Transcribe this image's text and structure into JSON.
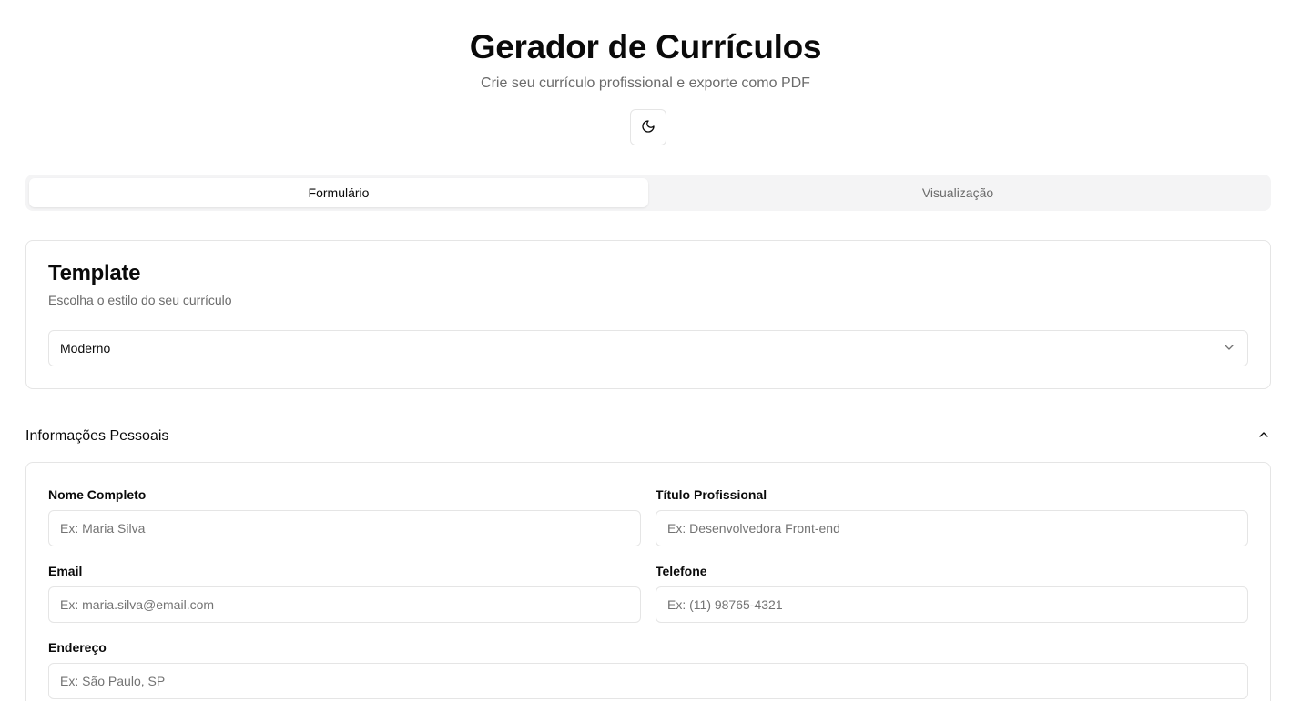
{
  "header": {
    "title": "Gerador de Currículos",
    "subtitle": "Crie seu currículo profissional e exporte como PDF",
    "theme_toggle_icon": "moon-icon"
  },
  "tabs": [
    {
      "label": "Formulário",
      "active": true
    },
    {
      "label": "Visualização",
      "active": false
    }
  ],
  "template_card": {
    "title": "Template",
    "description": "Escolha o estilo do seu currículo",
    "selected": "Moderno"
  },
  "personal_section": {
    "title": "Informações Pessoais",
    "expanded": true,
    "fields": {
      "full_name": {
        "label": "Nome Completo",
        "placeholder": "Ex: Maria Silva",
        "value": ""
      },
      "job_title": {
        "label": "Título Profissional",
        "placeholder": "Ex: Desenvolvedora Front-end",
        "value": ""
      },
      "email": {
        "label": "Email",
        "placeholder": "Ex: maria.silva@email.com",
        "value": ""
      },
      "phone": {
        "label": "Telefone",
        "placeholder": "Ex: (11) 98765-4321",
        "value": ""
      },
      "address": {
        "label": "Endereço",
        "placeholder": "Ex: São Paulo, SP",
        "value": ""
      }
    }
  },
  "colors": {
    "text": "#0a0a0a",
    "muted": "#6b6b6b",
    "border": "#e5e5e5",
    "tab_bg": "#f4f4f5"
  }
}
